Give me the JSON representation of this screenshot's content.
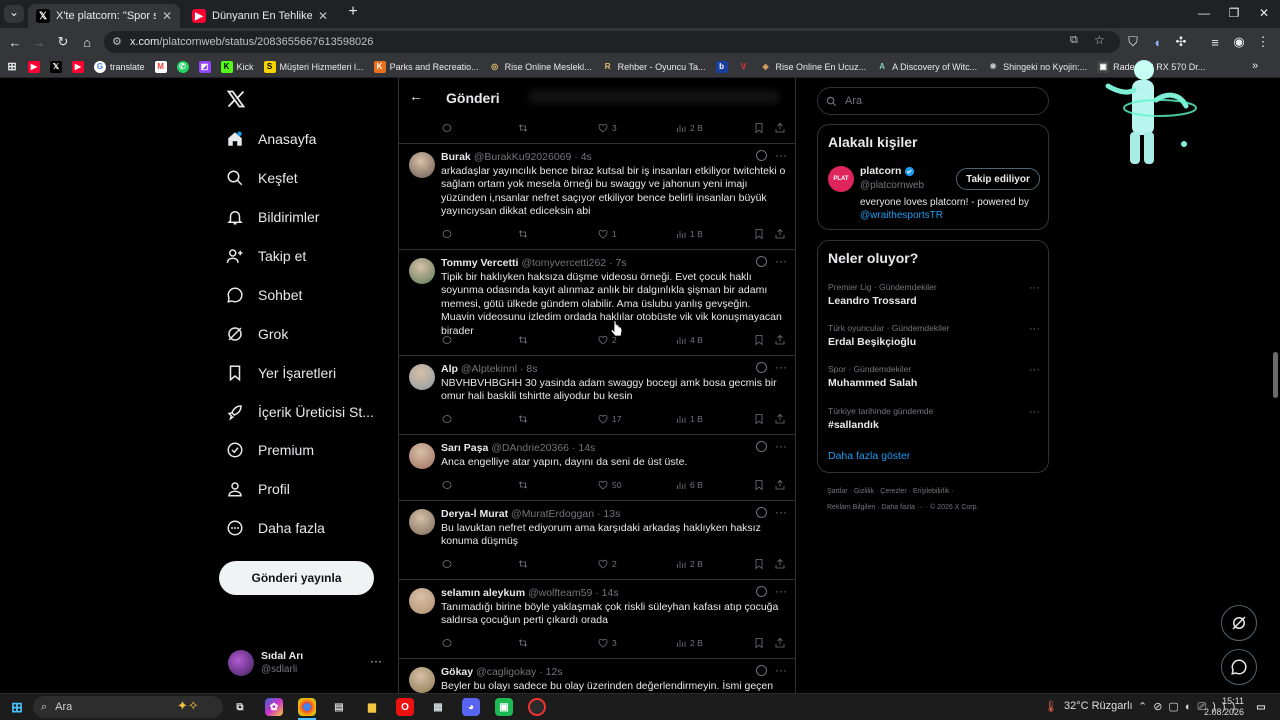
{
  "browser": {
    "tabs": [
      {
        "title": "X'te platcorn: \"Spor salonunda",
        "active": true
      },
      {
        "title": "Dünyanın En Tehlikeli Deniz Can",
        "active": false
      }
    ],
    "url_host": "x.com",
    "url_path": "/platcornweb/status/2083655667613598026",
    "bookmarks": [
      "translate",
      "Kick",
      "Müşteri Hizmetleri l...",
      "Parks and Recreatio...",
      "Rise Online Meslekl...",
      "Rehber - Oyuncu Ta...",
      "Rise Online En Ucuz...",
      "A Discovery of Witc...",
      "Shingeki no Kyojin:...",
      "Radeon™ RX 570 Dr..."
    ]
  },
  "nav": {
    "items": [
      "Anasayfa",
      "Keşfet",
      "Bildirimler",
      "Takip et",
      "Sohbet",
      "Grok",
      "Yer İşaretleri",
      "İçerik Üreticisi St...",
      "Premium",
      "Profil",
      "Daha fazla"
    ],
    "post_button": "Gönderi yayınla",
    "account": {
      "name": "Sıdal Arı",
      "handle": "@sdlarli"
    }
  },
  "header": {
    "title": "Gönderi"
  },
  "top_actions": {
    "likes": "3",
    "views": "2 B"
  },
  "tweets": [
    {
      "name": "Burak",
      "handle": "@BurakKu92026069",
      "time": "4s",
      "text": "arkadaşlar yayıncılık  bence biraz kutsal bir iş insanları etkiliyor twitchteki o sağlam ortam yok mesela örneği bu swaggy ve jahonun yeni imajı yüzünden i,nsanlar nefret saçıyor etkiliyor bence belirli insanları büyük yayıncıysan dikkat edіceksin abi",
      "likes": "1",
      "views": "1 B"
    },
    {
      "name": "Tommy Vercetti",
      "handle": "@tomyvercetti262",
      "time": "7s",
      "text": "Tipik bir haklıyken haksıza düşme videosu örneği. Evet çocuk haklı soyunma odasında kayıt alınmaz anlık bir dalgınlıkla şişman bir adamı memesi, götü ülkede gündem olabilir. Ama üslubu yanlış gevşeğin. Muavin videosunu izledim ordada haklılar otobüste vik vik konuşmayacan birader",
      "likes": "2",
      "views": "4 B"
    },
    {
      "name": "Alp",
      "handle": "@Alptekinnl",
      "time": "8s",
      "text": "NBVHBVHBGHH 30 yasinda adam swaggy bocegi amk bosa gecmis bir omur hali baskili tshirtte aliyodur bu kesin",
      "likes": "17",
      "views": "1 B"
    },
    {
      "name": "Sarı Paşa",
      "handle": "@DAndrie20366",
      "time": "14s",
      "text": "Anca engelliye atar yapın, dayını da seni de üst üste.",
      "likes": "50",
      "views": "6 B"
    },
    {
      "name": "Derya-İ Murat",
      "handle": "@MuratErdoggan",
      "time": "13s",
      "text": "Bu lavuktan nefret ediyorum ama karşıdaki arkadaş haklıyken haksız konuma düşmüş",
      "likes": "2",
      "views": "2 B"
    },
    {
      "name": "selamın aleykum",
      "handle": "@wolfteam59",
      "time": "14s",
      "text": "Tanımadığı birine böyle yaklaşmak çok riskli süleyhan kafası atıp çocuğa saldırsa çocuğun perti çıkardı orada",
      "likes": "3",
      "views": "2 B"
    },
    {
      "name": "Gökay",
      "handle": "@cagligokay",
      "time": "12s",
      "text": "Beyler bu olayı sadece bu olay üzerinden değerlendirmeyin. İsmi geçen",
      "likes": "",
      "views": ""
    }
  ],
  "right": {
    "search_placeholder": "Ara",
    "related_title": "Alakalı kişiler",
    "related": {
      "name": "platcorn",
      "handle": "@platcornweb",
      "follow": "Takip ediliyor",
      "bio": "everyone loves platcorn! - powered by",
      "bio_link": "@wraithesportsTR"
    },
    "trends_title": "Neler oluyor?",
    "trends": [
      {
        "cat": "Premier Lig · Gündemdekiler",
        "title": "Leandro Trossard"
      },
      {
        "cat": "Türk oyuncular · Gündemdekiler",
        "title": "Erdal Beşikçioğlu"
      },
      {
        "cat": "Spor · Gündemdekiler",
        "title": "Muhammed Salah"
      },
      {
        "cat": "Türkiye tarihinde gündemde",
        "title": "#sallandık"
      }
    ],
    "show_more": "Daha fazla göster",
    "footer1": "Şartlar  ·  Gizlilik  ·  Çerezler  ·  Erişilebilirlik  ·",
    "footer2": "Reklam Bilgileri  ·  Daha fazla ···  ·  © 2026 X Corp."
  },
  "taskbar": {
    "search": "Ara",
    "weather": "32°C  Rüzgarlı",
    "time": "15:11",
    "date": "2.08.2026"
  },
  "colors": {
    "accent": "#1d9bf0",
    "bg": "#000000",
    "border": "#2f3336",
    "muted": "#71767b"
  }
}
